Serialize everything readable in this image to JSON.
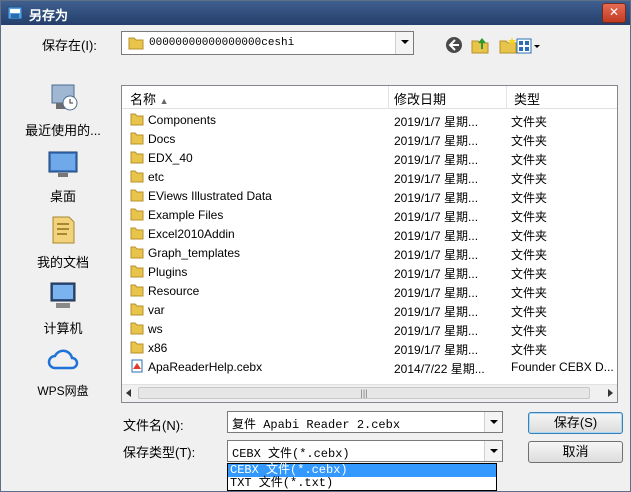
{
  "window": {
    "title": "另存为",
    "close_glyph": "✕"
  },
  "save_in": {
    "label": "保存在(I):",
    "value": "00000000000000000ceshi"
  },
  "places": [
    {
      "label": "最近使用的...",
      "icon": "recent-places-icon"
    },
    {
      "label": "桌面",
      "icon": "desktop-icon"
    },
    {
      "label": "我的文档",
      "icon": "documents-icon"
    },
    {
      "label": "计算机",
      "icon": "computer-icon"
    },
    {
      "label": "WPS网盘",
      "icon": "wps-cloud-icon"
    }
  ],
  "columns": {
    "name": "名称",
    "modified": "修改日期",
    "type": "类型"
  },
  "files": [
    {
      "name": "Components",
      "date": "2019/1/7 星期...",
      "type": "文件夹",
      "icon": "folder-icon"
    },
    {
      "name": "Docs",
      "date": "2019/1/7 星期...",
      "type": "文件夹",
      "icon": "folder-icon"
    },
    {
      "name": "EDX_40",
      "date": "2019/1/7 星期...",
      "type": "文件夹",
      "icon": "folder-icon"
    },
    {
      "name": "etc",
      "date": "2019/1/7 星期...",
      "type": "文件夹",
      "icon": "folder-icon"
    },
    {
      "name": "EViews Illustrated Data",
      "date": "2019/1/7 星期...",
      "type": "文件夹",
      "icon": "folder-icon"
    },
    {
      "name": "Example Files",
      "date": "2019/1/7 星期...",
      "type": "文件夹",
      "icon": "folder-icon"
    },
    {
      "name": "Excel2010Addin",
      "date": "2019/1/7 星期...",
      "type": "文件夹",
      "icon": "folder-icon"
    },
    {
      "name": "Graph_templates",
      "date": "2019/1/7 星期...",
      "type": "文件夹",
      "icon": "folder-icon"
    },
    {
      "name": "Plugins",
      "date": "2019/1/7 星期...",
      "type": "文件夹",
      "icon": "folder-icon"
    },
    {
      "name": "Resource",
      "date": "2019/1/7 星期...",
      "type": "文件夹",
      "icon": "folder-icon"
    },
    {
      "name": "var",
      "date": "2019/1/7 星期...",
      "type": "文件夹",
      "icon": "folder-icon"
    },
    {
      "name": "ws",
      "date": "2019/1/7 星期...",
      "type": "文件夹",
      "icon": "folder-icon"
    },
    {
      "name": "x86",
      "date": "2019/1/7 星期...",
      "type": "文件夹",
      "icon": "folder-icon"
    },
    {
      "name": "ApaReaderHelp.cebx",
      "date": "2014/7/22 星期...",
      "type": "Founder CEBX D...",
      "icon": "cebx-file-icon"
    }
  ],
  "filename": {
    "label": "文件名(N):",
    "value": "复件 Apabi Reader 2.cebx"
  },
  "filetype": {
    "label": "保存类型(T):",
    "value": "CEBX 文件(*.cebx)",
    "options": [
      "CEBX 文件(*.cebx)",
      "TXT 文件(*.txt)"
    ]
  },
  "buttons": {
    "save": "保存(S)",
    "cancel": "取消"
  },
  "colors": {
    "folder": "#e8c44a",
    "selection": "#3399ff",
    "titlebar": "#2f4d7c"
  }
}
